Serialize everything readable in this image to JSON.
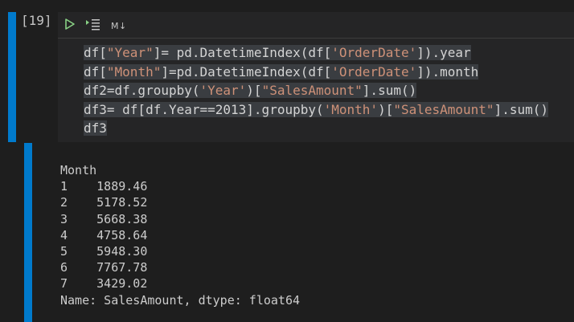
{
  "cell": {
    "execution_count": "[19]",
    "toolbar": {
      "run_icon": "play-icon",
      "run_by_line_icon": "run-by-line-icon",
      "markdown_label": "M↓"
    },
    "code_lines": [
      [
        {
          "t": "df[",
          "k": "plain"
        },
        {
          "t": "\"Year\"",
          "k": "str"
        },
        {
          "t": "]= pd.DatetimeIndex(df[",
          "k": "plain"
        },
        {
          "t": "'OrderDate'",
          "k": "str"
        },
        {
          "t": "]).year",
          "k": "plain"
        }
      ],
      [
        {
          "t": "df[",
          "k": "plain"
        },
        {
          "t": "\"Month\"",
          "k": "str"
        },
        {
          "t": "]=pd.DatetimeIndex(df[",
          "k": "plain"
        },
        {
          "t": "'OrderDate'",
          "k": "str"
        },
        {
          "t": "]).month",
          "k": "plain"
        }
      ],
      [
        {
          "t": "df2=df.groupby(",
          "k": "plain"
        },
        {
          "t": "'Year'",
          "k": "str"
        },
        {
          "t": ")[",
          "k": "plain"
        },
        {
          "t": "\"SalesAmount\"",
          "k": "str"
        },
        {
          "t": "].sum()",
          "k": "plain"
        }
      ],
      [
        {
          "t": "df3= df[df.Year==2013].groupby(",
          "k": "plain"
        },
        {
          "t": "'Month'",
          "k": "str"
        },
        {
          "t": ")[",
          "k": "plain"
        },
        {
          "t": "\"SalesAmount\"",
          "k": "str"
        },
        {
          "t": "].sum()",
          "k": "plain"
        }
      ],
      [
        {
          "t": "df3",
          "k": "plain"
        }
      ]
    ]
  },
  "output": {
    "lines": [
      "Month",
      "1    1889.46",
      "2    5178.52",
      "3    5668.38",
      "4    4758.64",
      "5    5948.30",
      "6    7767.78",
      "7    3429.02",
      "Name: SalesAmount, dtype: float64"
    ]
  },
  "colors": {
    "accent": "#007acc",
    "string": "#ce9178",
    "run_icon": "#89d185"
  }
}
